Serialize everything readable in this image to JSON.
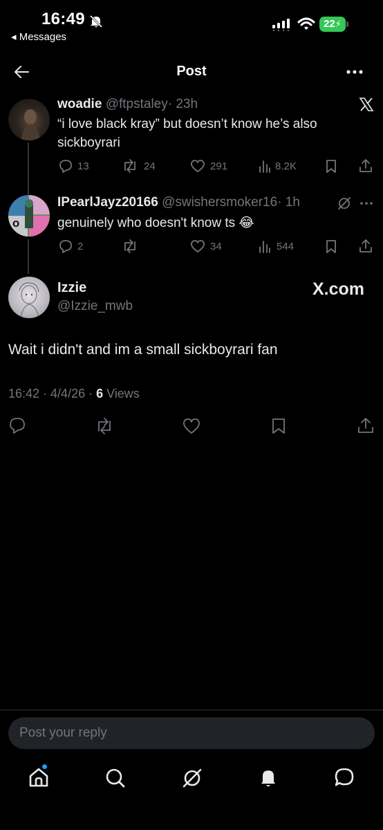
{
  "status_bar": {
    "time": "16:49",
    "back_app": "◂ Messages",
    "battery": "22"
  },
  "header": {
    "title": "Post",
    "back_icon": "arrow-left-icon",
    "more_icon": "more-horizontal-icon"
  },
  "thread": [
    {
      "display_name": "woadie",
      "handle": "@ftpstaley",
      "time": "· 23h",
      "text": "“i love black kray” but doesn’t know he’s also sickboyrari",
      "replies": "13",
      "reposts": "24",
      "likes": "291",
      "views": "8.2K"
    },
    {
      "display_name": "IPearlJayz20166",
      "handle": "@swishersmoker16",
      "time": "· 1h",
      "text": "genuinely who doesn't know ts 😂",
      "replies": "2",
      "reposts": "",
      "likes": "34",
      "views": "544"
    }
  ],
  "main_post": {
    "display_name": "Izzie",
    "handle": "@Izzie_mwb",
    "watermark": "X.com",
    "text": "Wait i didn't and im a small sickboyrari fan",
    "timestamp": "16:42 · 4/4/26 · ",
    "views_count": "6",
    "views_label": " Views"
  },
  "reply": {
    "placeholder": "Post your reply"
  },
  "bottom_nav": [
    "home",
    "search",
    "grok",
    "notifications",
    "messages"
  ],
  "colors": {
    "background": "#000000",
    "text": "#e7e9ea",
    "muted": "#71767b",
    "accent": "#1d9bf0",
    "battery": "#34c759"
  }
}
